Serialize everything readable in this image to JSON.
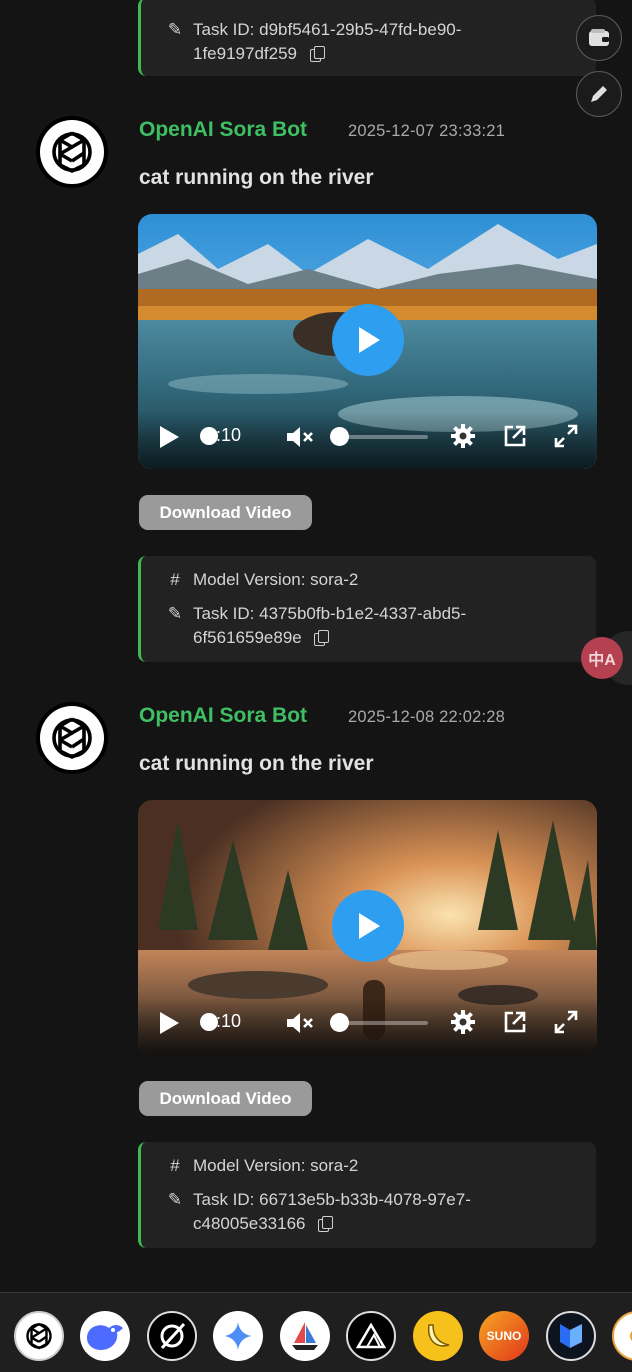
{
  "top_card": {
    "task_label": "Task ID:",
    "task_id_line1": "d9bf5461-29b5-47fd-be90-",
    "task_id_line2": "1fe9197df259"
  },
  "messages": [
    {
      "sender": "OpenAI Sora Bot",
      "timestamp": "2025-12-07 23:33:21",
      "prompt": "cat running on the river",
      "video_time": "0:10",
      "download_label": "Download Video",
      "model_label": "Model Version: sora-2",
      "task_label": "Task ID:",
      "task_id_line1": "4375b0fb-b1e2-4337-abd5-",
      "task_id_line2": "6f561659e89e"
    },
    {
      "sender": "OpenAI Sora Bot",
      "timestamp": "2025-12-08 22:02:28",
      "prompt": "cat running on the river",
      "video_time": "0:10",
      "download_label": "Download Video",
      "model_label": "Model Version: sora-2",
      "task_label": "Task ID:",
      "task_id_line1": "66713e5b-b33b-4078-97e7-",
      "task_id_line2": "c48005e33166"
    }
  ],
  "floating": {
    "wallet_icon": "wallet-icon",
    "edit_icon": "pencil-icon",
    "translate_label": "中A"
  },
  "dock": {
    "items": [
      "openai-icon",
      "deepseek-icon",
      "grok-icon",
      "gemini-icon",
      "sailboat-icon",
      "black-forest-labs-icon",
      "banana-icon",
      "suno-icon",
      "blue-logo-icon",
      "partial-icon"
    ],
    "suno_label": "SUNO"
  },
  "colors": {
    "background": "#141414",
    "sender_green": "#3fbf63",
    "card_border_green": "#3fb950",
    "play_blue": "#2d9ef0",
    "download_bg": "#9a9a9a",
    "translate_red": "#b5404f"
  }
}
